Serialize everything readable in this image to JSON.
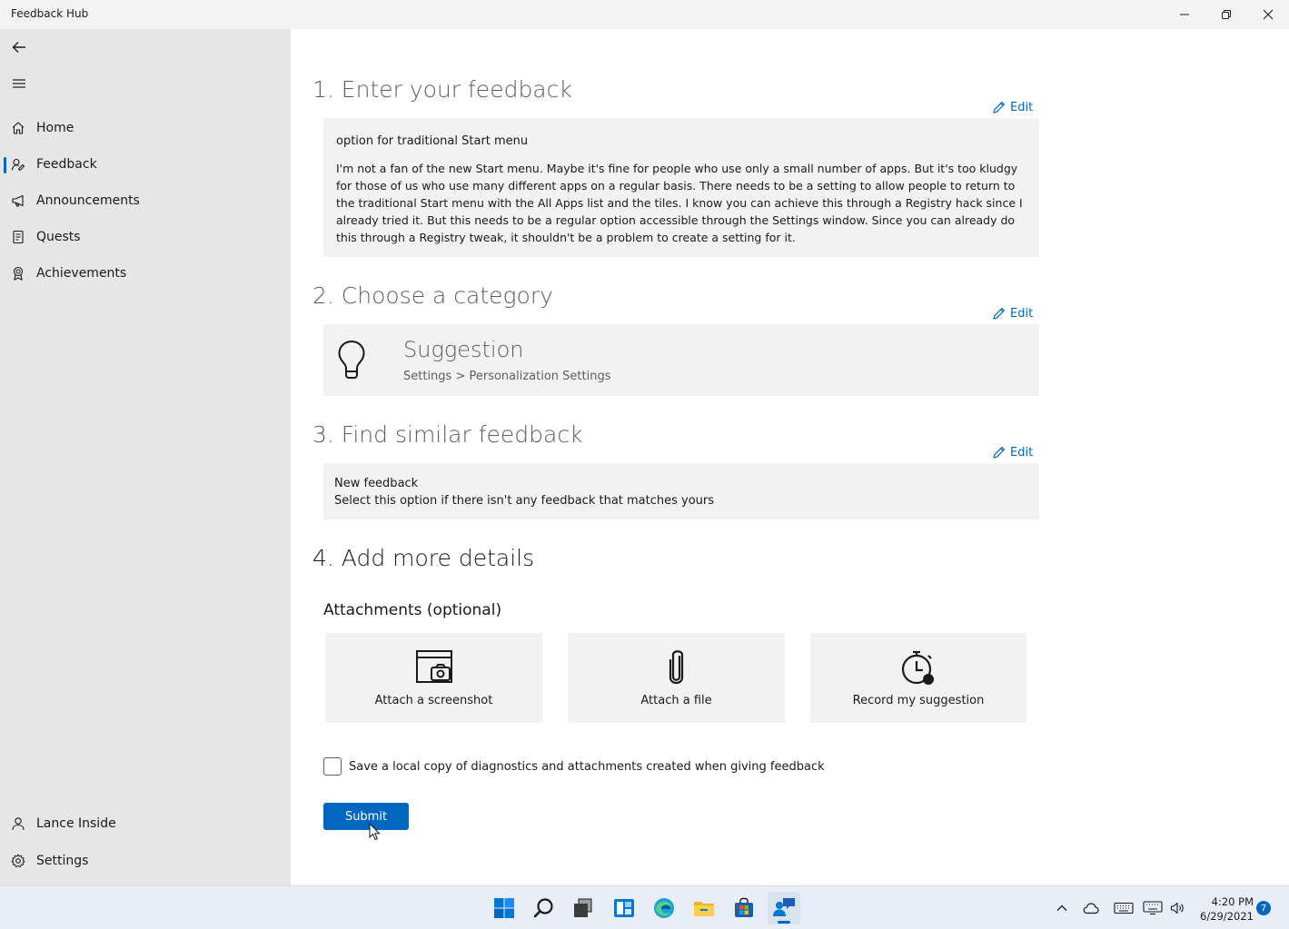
{
  "window": {
    "title": "Feedback Hub"
  },
  "sidebar": {
    "items": [
      {
        "label": "Home",
        "icon": "home-icon"
      },
      {
        "label": "Feedback",
        "icon": "feedback-icon",
        "active": true
      },
      {
        "label": "Announcements",
        "icon": "megaphone-icon"
      },
      {
        "label": "Quests",
        "icon": "quests-icon"
      },
      {
        "label": "Achievements",
        "icon": "badge-icon"
      }
    ],
    "footer": [
      {
        "label": "Lance Inside",
        "icon": "person-icon"
      },
      {
        "label": "Settings",
        "icon": "gear-icon"
      }
    ]
  },
  "steps": {
    "enter": {
      "title": "1. Enter your feedback",
      "edit_label": "Edit",
      "feedback_title": "option for traditional Start menu",
      "feedback_body": "I'm not a fan of the new Start menu. Maybe it's fine for people who use only a small number of apps. But it's too kludgy for those of us who use many different apps on a regular basis. There needs to be a setting to allow people to return to the traditional Start menu with the All Apps list and the tiles. I know you can achieve this through a Registry hack since I already tried it. But this needs to be a regular option accessible through the Settings window. Since you can already do this through a Registry tweak, it shouldn't be a problem to create a setting for it."
    },
    "category": {
      "title": "2. Choose a category",
      "edit_label": "Edit",
      "name": "Suggestion",
      "path": "Settings > Personalization Settings"
    },
    "similar": {
      "title": "3. Find similar feedback",
      "edit_label": "Edit",
      "option_title": "New feedback",
      "option_desc": "Select this option if there isn't any feedback that matches yours"
    },
    "details": {
      "title": "4. Add more details",
      "attachments_heading": "Attachments (optional)",
      "attachments": [
        {
          "label": "Attach a screenshot",
          "icon": "screenshot-icon"
        },
        {
          "label": "Attach a file",
          "icon": "paperclip-icon"
        },
        {
          "label": "Record my suggestion",
          "icon": "stopwatch-record-icon"
        }
      ],
      "save_copy_label": "Save a local copy of diagnostics and attachments created when giving feedback",
      "save_copy_checked": false,
      "submit_label": "Submit"
    }
  },
  "taskbar": {
    "apps": [
      "start-icon",
      "search-icon",
      "task-view-icon",
      "widgets-icon",
      "edge-icon",
      "file-explorer-icon",
      "store-icon",
      "feedback-hub-icon"
    ],
    "clock_time": "4:20 PM",
    "clock_date": "6/29/2021",
    "notification_count": "7"
  },
  "colors": {
    "accent": "#0067c0",
    "sidebar_bg": "#e6e6e6",
    "panel_bg": "#f2f2f2"
  }
}
